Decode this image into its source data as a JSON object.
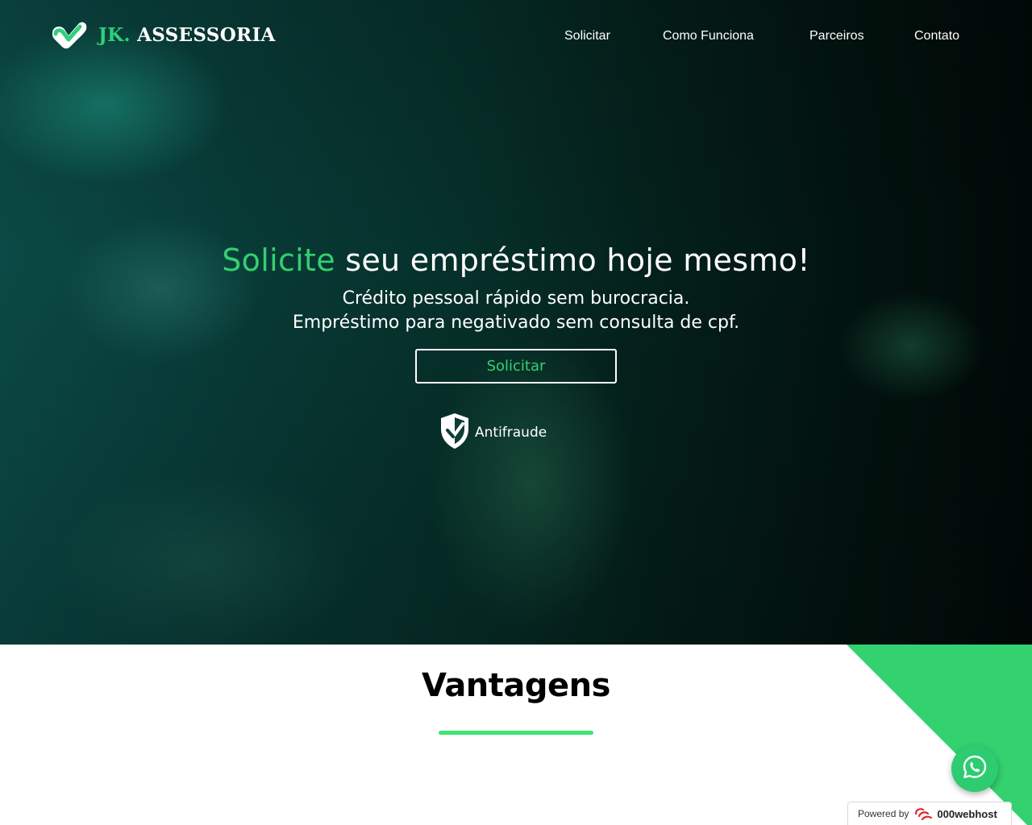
{
  "brand": {
    "jk": "JK.",
    "name": "ASSESSORIA"
  },
  "nav": {
    "items": [
      {
        "label": "Solicitar"
      },
      {
        "label": "Como Funciona"
      },
      {
        "label": "Parceiros"
      },
      {
        "label": "Contato"
      }
    ]
  },
  "hero": {
    "headline_accent": "Solicite",
    "headline_rest": " seu empréstimo hoje mesmo!",
    "line1": "Crédito pessoal rápido sem burocracia.",
    "line2": "Empréstimo para negativado sem consulta de cpf.",
    "cta_label": "Solicitar",
    "badge_label": "Antifraude"
  },
  "advantages": {
    "title": "Vantagens"
  },
  "footer_badge": {
    "powered_label": "Powered by",
    "brand": "000webhost"
  },
  "colors": {
    "accent": "#33d16f",
    "hero_overlay": "#0b4a46",
    "whatsapp": "#2ecc71"
  },
  "icons": {
    "logo": "check-heart-icon",
    "shield": "shield-check-icon",
    "whatsapp": "whatsapp-icon",
    "webhost": "000webhost-logo-icon"
  }
}
